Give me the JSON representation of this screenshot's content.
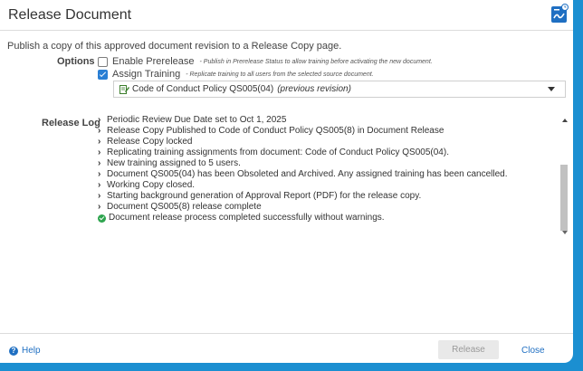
{
  "dialog": {
    "title": "Release Document",
    "logo_icon": "app-logo-icon"
  },
  "intro": "Publish a copy of this approved document revision to a Release Copy page.",
  "options": {
    "label": "Options",
    "enable_prerelease": {
      "label": "Enable Prerelease",
      "hint": "- Publish in Prerelease Status to allow training before activating the new document.",
      "checked": false
    },
    "assign_training": {
      "label": "Assign Training",
      "hint": "- Replicate training to all users from the selected source document.",
      "checked": true
    },
    "source_select": {
      "value": "Code of Conduct Policy QS005(04)",
      "suffix": "(previous revision)",
      "icon": "document-edit-icon"
    }
  },
  "release_log": {
    "label": "Release Log",
    "items": [
      "Periodic Review Due Date set to Oct 1, 2025",
      "Release Copy Published to Code of Conduct Policy QS005(8) in Document Release",
      "Release Copy locked",
      "Replicating training assignments from document: Code of Conduct Policy QS005(04).",
      "New training assigned to 5 users.",
      "Document QS005(04) has been Obsoleted and Archived. Any assigned training has been cancelled.",
      "Working Copy closed.",
      "Starting background generation of Approval Report (PDF) for the release copy.",
      "Document QS005(8) release complete"
    ],
    "final": "Document release process completed successfully without warnings."
  },
  "footer": {
    "help_label": "Help",
    "release_label": "Release",
    "close_label": "Close"
  },
  "colors": {
    "accent": "#1f6fc2",
    "frame": "#1b8fd1",
    "success": "#2da44e"
  }
}
